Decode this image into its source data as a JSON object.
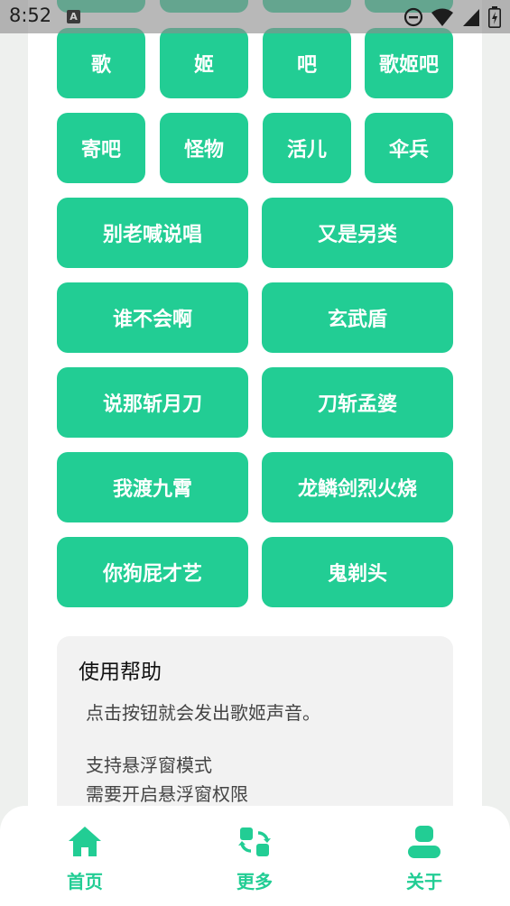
{
  "status_bar": {
    "time": "8:52",
    "keyboard_badge": "A",
    "icons": [
      "a-badge-icon",
      "do-not-disturb-icon",
      "wifi-icon",
      "signal-icon",
      "battery-icon"
    ]
  },
  "buttons": {
    "row1": [
      "歌",
      "姬",
      "吧",
      "歌姬吧"
    ],
    "row2": [
      "寄吧",
      "怪物",
      "活儿",
      "伞兵"
    ],
    "wide": [
      [
        "别老喊说唱",
        "又是另类"
      ],
      [
        "谁不会啊",
        "玄武盾"
      ],
      [
        "说那斩月刀",
        "刀斩孟婆"
      ],
      [
        "我渡九霄",
        "龙鳞剑烈火烧"
      ],
      [
        "你狗屁才艺",
        "鬼剃头"
      ]
    ]
  },
  "help": {
    "title": "使用帮助",
    "line1": "点击按钮就会发出歌姬声音。",
    "line2": "支持悬浮窗模式",
    "line3": "需要开启悬浮窗权限"
  },
  "nav": {
    "home": "首页",
    "more": "更多",
    "about": "关于"
  },
  "colors": {
    "accent": "#22cd94",
    "page_bg": "#eef0ee",
    "card_bg": "#ffffff",
    "help_bg": "#f2f2f2"
  }
}
